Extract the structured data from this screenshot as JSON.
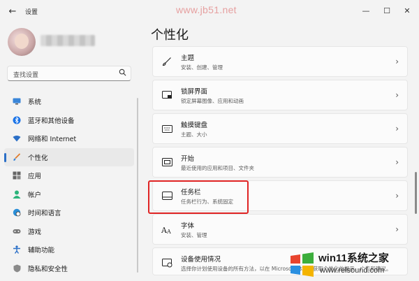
{
  "titlebar": {
    "back_glyph": "←",
    "title": "设置",
    "watermark": "www.jb51.net",
    "minimize_glyph": "—",
    "maximize_glyph": "☐",
    "close_glyph": "✕"
  },
  "search": {
    "placeholder": "查找设置",
    "icon": "search-icon"
  },
  "sidebar": {
    "items": [
      {
        "label": "系统",
        "icon": "monitor-icon",
        "color": "#2b6fc7"
      },
      {
        "label": "蓝牙和其他设备",
        "icon": "bluetooth-icon",
        "color": "#1a73e8"
      },
      {
        "label": "网络和 Internet",
        "icon": "wifi-icon",
        "color": "#2b6fc7"
      },
      {
        "label": "个性化",
        "icon": "brush-icon",
        "color": "#e07a2b",
        "active": true
      },
      {
        "label": "应用",
        "icon": "apps-icon",
        "color": "#555555"
      },
      {
        "label": "帐户",
        "icon": "person-icon",
        "color": "#2bb37a"
      },
      {
        "label": "时间和语言",
        "icon": "globe-clock-icon",
        "color": "#2b6fc7"
      },
      {
        "label": "游戏",
        "icon": "gamepad-icon",
        "color": "#555555"
      },
      {
        "label": "辅助功能",
        "icon": "accessibility-icon",
        "color": "#2b6fc7"
      },
      {
        "label": "隐私和安全性",
        "icon": "shield-icon",
        "color": "#777777"
      }
    ]
  },
  "main": {
    "title": "个性化",
    "cards": [
      {
        "title": "主题",
        "subtitle": "安装、创建、管理",
        "icon": "paintbrush-icon"
      },
      {
        "title": "锁屏界面",
        "subtitle": "锁定屏幕图像、应用和动画",
        "icon": "lock-screen-icon"
      },
      {
        "title": "触摸键盘",
        "subtitle": "主题、大小",
        "icon": "keyboard-icon"
      },
      {
        "title": "开始",
        "subtitle": "最近使用的应用和项目、文件夹",
        "icon": "start-icon"
      },
      {
        "title": "任务栏",
        "subtitle": "任务栏行为、系统固定",
        "icon": "taskbar-icon"
      },
      {
        "title": "字体",
        "subtitle": "安装、管理",
        "icon": "font-icon"
      },
      {
        "title": "设备使用情况",
        "subtitle": "选择你计划使用设备的所有方法，以在 Microsoft 体验中获取个性化的提示、广告和建议。",
        "icon": "device-usage-icon"
      }
    ],
    "chevron": "›"
  },
  "logo": {
    "name": "win11系统之家",
    "url": "www.relsound.com"
  },
  "colors": {
    "accent": "#2b6fc7",
    "highlight_border": "#e02424"
  }
}
